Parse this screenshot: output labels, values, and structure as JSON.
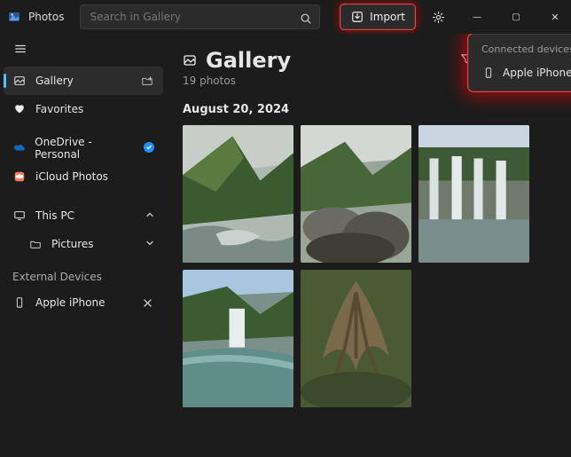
{
  "app": {
    "title": "Photos",
    "search_placeholder": "Search in Gallery",
    "import_label": "Import"
  },
  "sidebar": {
    "items": [
      {
        "icon": "gallery",
        "label": "Gallery",
        "selected": true,
        "trail": "folder-plus"
      },
      {
        "icon": "heart",
        "label": "Favorites"
      }
    ],
    "cloud": [
      {
        "icon": "onedrive",
        "label": "OneDrive - Personal",
        "badge": "sync"
      },
      {
        "icon": "icloud",
        "label": "iCloud Photos"
      }
    ],
    "pc": {
      "label": "This PC",
      "expanded": true,
      "children": [
        {
          "icon": "folder",
          "label": "Pictures"
        }
      ]
    },
    "external_header": "External Devices",
    "external": [
      {
        "icon": "phone",
        "label": "Apple iPhone",
        "trail": "close"
      }
    ]
  },
  "page": {
    "title": "Gallery",
    "subtitle": "19 photos",
    "date_group": "August 20, 2024"
  },
  "popover": {
    "header": "Connected devices",
    "device": "Apple iPhone"
  },
  "thumbs": [
    {
      "palette": "mountain-river"
    },
    {
      "palette": "boulders-valley"
    },
    {
      "palette": "multi-falls"
    },
    {
      "palette": "waterfall-pool"
    },
    {
      "palette": "roots-bush"
    }
  ]
}
